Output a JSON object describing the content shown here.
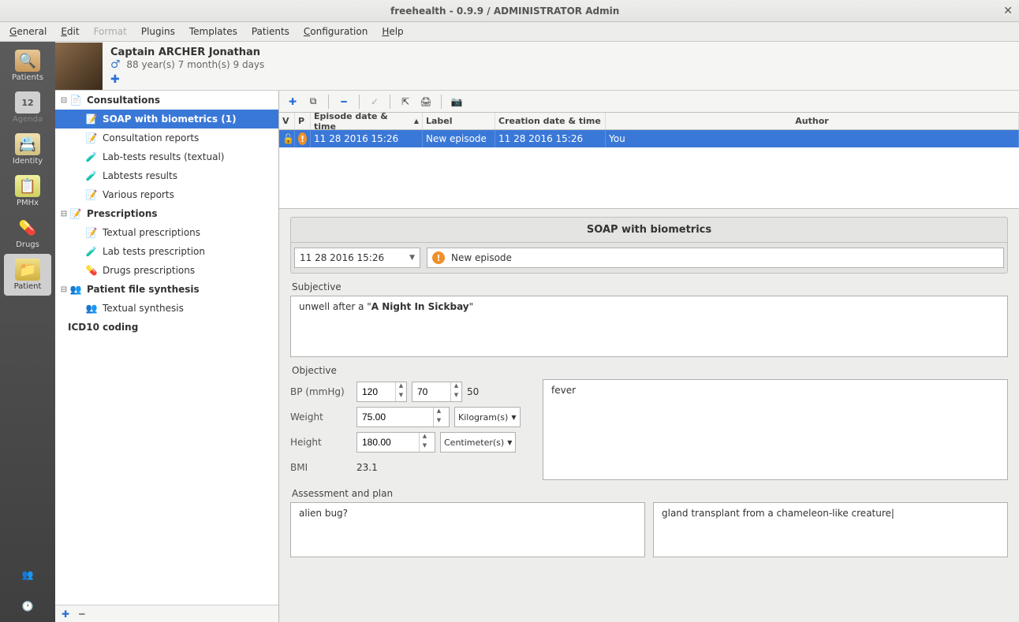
{
  "window": {
    "title": "freehealth - 0.9.9 /  ADMINISTRATOR Admin"
  },
  "menubar": {
    "general": "General",
    "edit": "Edit",
    "format": "Format",
    "plugins": "Plugins",
    "templates": "Templates",
    "patients": "Patients",
    "configuration": "Configuration",
    "help": "Help"
  },
  "sidebar": {
    "items": [
      {
        "label": "Patients"
      },
      {
        "label": "Agenda"
      },
      {
        "label": "Identity"
      },
      {
        "label": "PMHx"
      },
      {
        "label": "Drugs"
      },
      {
        "label": "Patient"
      }
    ]
  },
  "patient": {
    "name": "Captain ARCHER Jonathan",
    "gender_symbol": "♂",
    "age": "88 year(s) 7 month(s) 9 days"
  },
  "tree": {
    "consultations": "Consultations",
    "soap": "SOAP with biometrics (1)",
    "consult_reports": "Consultation reports",
    "labtests_textual": "Lab-tests results (textual)",
    "labtests": "Labtests results",
    "various": "Various reports",
    "prescriptions": "Prescriptions",
    "textual_presc": "Textual prescriptions",
    "lab_presc": "Lab tests prescription",
    "drugs_presc": "Drugs prescriptions",
    "synthesis": "Patient file synthesis",
    "textual_synth": "Textual synthesis",
    "icd10": "ICD10 coding"
  },
  "episodes": {
    "headers": {
      "v": "V",
      "p": "P",
      "date": "Episode date & time",
      "label": "Label",
      "creation": "Creation date & time",
      "author": "Author"
    },
    "rows": [
      {
        "date": "11 28 2016 15:26",
        "label": "New episode",
        "creation": "11 28 2016 15:26",
        "author": "You"
      }
    ]
  },
  "form": {
    "title": "SOAP with biometrics",
    "episode_date": "11 28 2016 15:26",
    "episode_label": "New episode",
    "subjective_label": "Subjective",
    "subjective_pre": "unwell after a \"",
    "subjective_bold": "A Night In Sickbay",
    "subjective_post": "\"",
    "objective_label": "Objective",
    "bp_label": "BP (mmHg)",
    "bp_sys": "120",
    "bp_dia": "70",
    "bp_diff": "50",
    "weight_label": "Weight",
    "weight_val": "75.00",
    "weight_unit": "Kilogram(s)",
    "height_label": "Height",
    "height_val": "180.00",
    "height_unit": "Centimeter(s)",
    "bmi_label": "BMI",
    "bmi_val": "23.1",
    "obj_text": "fever",
    "ap_label": "Assessment and plan",
    "assessment": "alien bug?",
    "plan": "gland transplant from a chameleon-like creature"
  }
}
